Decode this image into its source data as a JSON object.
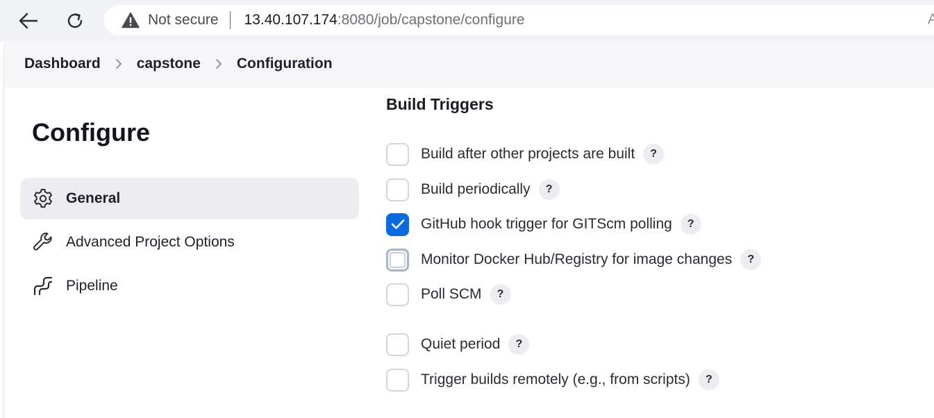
{
  "browser": {
    "back_icon": "arrow-left-icon",
    "reload_icon": "reload-icon",
    "security_icon": "warning-triangle-icon",
    "security_label": "Not secure",
    "url_host": "13.40.107.174",
    "url_path": ":8080/job/capstone/configure",
    "url_trailing": "A"
  },
  "breadcrumb": {
    "items": [
      "Dashboard",
      "capstone",
      "Configuration"
    ]
  },
  "sidebar": {
    "title": "Configure",
    "items": [
      {
        "label": "General",
        "icon": "gear-icon",
        "active": true
      },
      {
        "label": "Advanced Project Options",
        "icon": "wrench-icon",
        "active": false
      },
      {
        "label": "Pipeline",
        "icon": "pipeline-icon",
        "active": false
      }
    ]
  },
  "main": {
    "section_title": "Build Triggers",
    "help_label": "?",
    "triggers": [
      {
        "label": "Build after other projects are built",
        "checked": false
      },
      {
        "label": "Build periodically",
        "checked": false
      },
      {
        "label": "GitHub hook trigger for GITScm polling",
        "checked": true
      },
      {
        "label": "Monitor Docker Hub/Registry for image changes",
        "checked": false
      },
      {
        "label": "Poll SCM",
        "checked": false
      },
      {
        "label": "Quiet period",
        "checked": false
      },
      {
        "label": "Trigger builds remotely (e.g., from scripts)",
        "checked": false
      }
    ]
  },
  "colors": {
    "accent": "#0b6bde",
    "active_item_bg": "#ebebf0",
    "breadcrumb_bg": "#f6f6f9"
  }
}
